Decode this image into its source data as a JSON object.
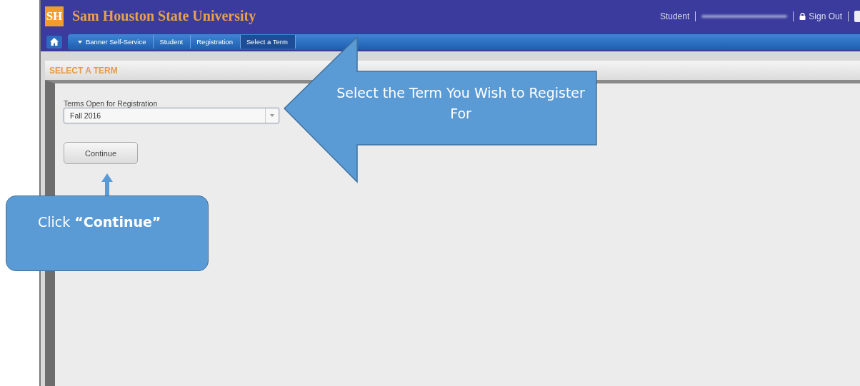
{
  "header": {
    "logo": "SH",
    "title": "Sam Houston State University",
    "user_role": "Student",
    "sign_out": "Sign Out"
  },
  "breadcrumbs": [
    {
      "label": "Banner Self-Service",
      "selected": false
    },
    {
      "label": "Student",
      "selected": false
    },
    {
      "label": "Registration",
      "selected": false
    },
    {
      "label": "Select a Term",
      "selected": true
    }
  ],
  "panel": {
    "title": "SELECT A TERM",
    "field_label": "Terms Open for Registration",
    "term_value": "Fall 2016",
    "button": "Continue"
  },
  "callouts": [
    {
      "kind": "left-arrow",
      "text": "Select the Term You Wish to Register For"
    },
    {
      "kind": "box-up",
      "text": "Click **“Continue”**"
    }
  ]
}
